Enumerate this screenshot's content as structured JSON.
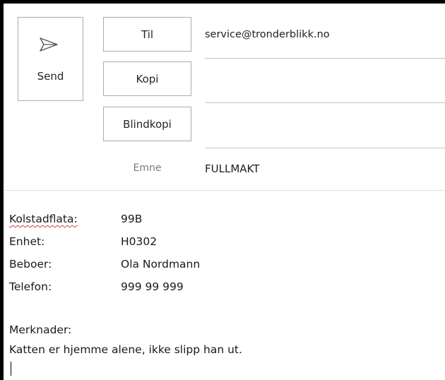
{
  "toolbar": {
    "send_label": "Send"
  },
  "header": {
    "to_label": "Til",
    "to_value": "service@tronderblikk.no",
    "cc_label": "Kopi",
    "cc_value": "",
    "bcc_label": "Blindkopi",
    "bcc_value": "",
    "subject_label": "Emne",
    "subject_value": "FULLMAKT"
  },
  "body": {
    "fields": [
      {
        "label": "Kolstadflata:",
        "value": "99B"
      },
      {
        "label": "Enhet:",
        "value": "H0302"
      },
      {
        "label": "Beboer:",
        "value": "Ola Nordmann"
      },
      {
        "label": "Telefon:",
        "value": "999 99 999"
      }
    ],
    "remarks_label": "Merknader:",
    "remarks_text": "Katten er hjemme alene, ikke slipp han ut."
  },
  "colors": {
    "border": "#ababab",
    "icon": "#555555",
    "spellcheck": "#d43b3b"
  },
  "icons": {
    "send": "paper-plane-icon"
  }
}
